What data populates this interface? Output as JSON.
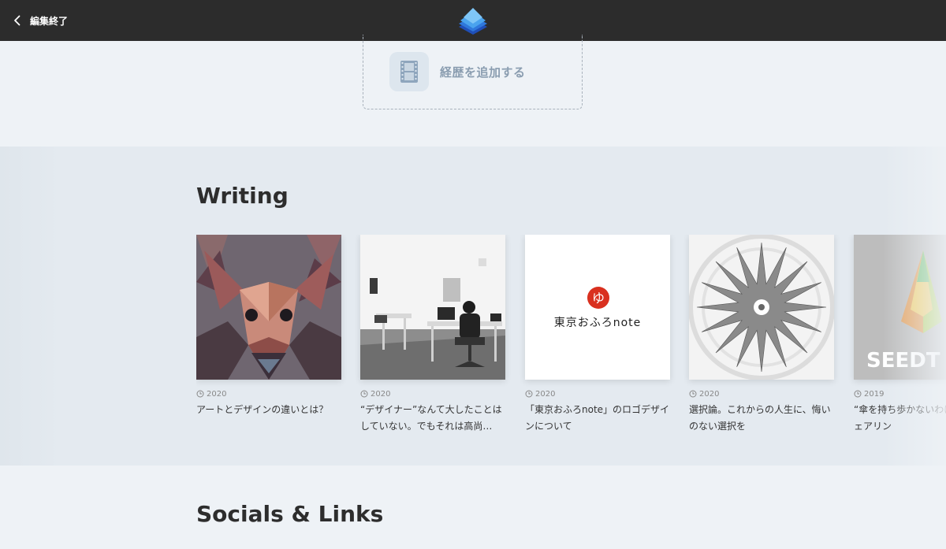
{
  "topbar": {
    "back_label": "編集終了",
    "logo_icon": "stacked-pages-logo"
  },
  "career": {
    "add_label": "経歴を追加する",
    "icon": "film-strip-icon"
  },
  "writing": {
    "title": "Writing",
    "articles": [
      {
        "year": "2020",
        "title": "アートとデザインの違いとは？",
        "image": "low-poly-deer"
      },
      {
        "year": "2020",
        "title": "“デザイナー”なんて大したことはしていない。でもそれは高尚…",
        "image": "designer-desk-photo"
      },
      {
        "year": "2020",
        "title": "「東京おふろnote」のロゴデザインについて",
        "image": "tokyo-ofuro-note-logo",
        "thumb_text": "東京おふろnote",
        "thumb_mark": "ゆ"
      },
      {
        "year": "2020",
        "title": "選択論。これからの人生に、悔いのない選択を",
        "image": "star-spiral-pattern"
      },
      {
        "year": "2019",
        "title": "“傘を持ち歩かないわげる“傘のシェアリン",
        "image": "seedt-umbrella",
        "thumb_text": "SEEDT"
      }
    ]
  },
  "socials": {
    "title": "Socials & Links"
  },
  "colors": {
    "topbar": "#2c2c2c",
    "background": "#eef2f6",
    "band": "#e4eaf0",
    "accent_red": "#d9301f"
  }
}
